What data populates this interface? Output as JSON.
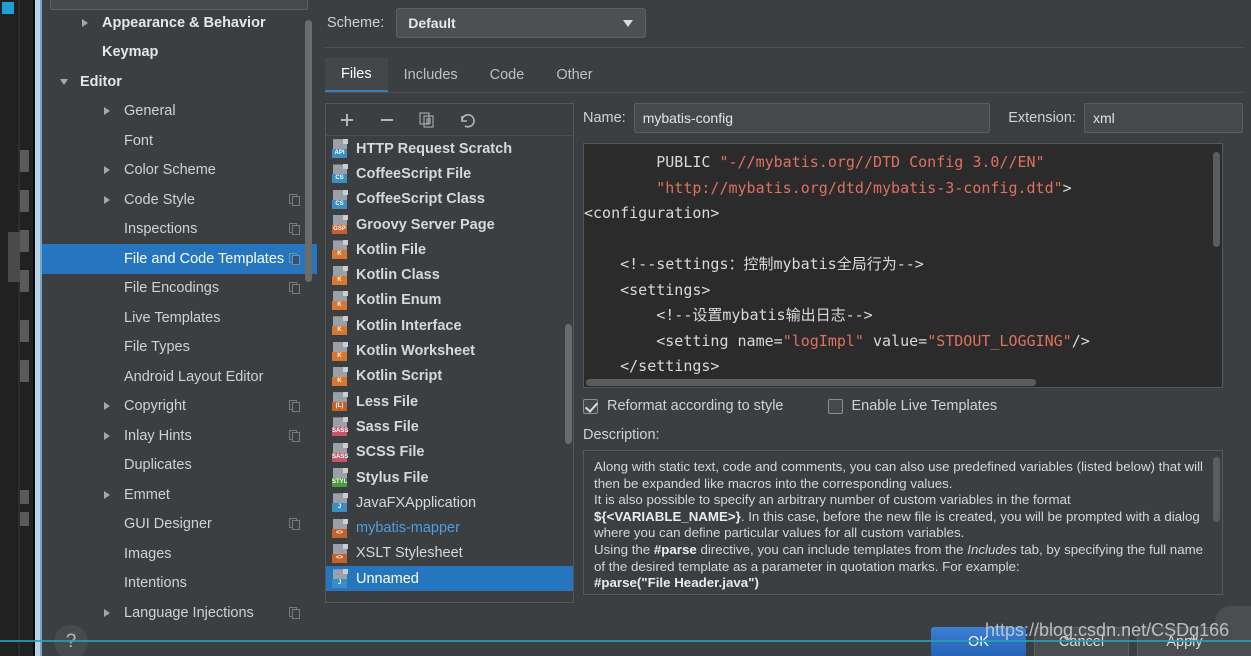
{
  "dialog": {
    "scheme_label": "Scheme:",
    "scheme_value": "Default",
    "tabs": [
      {
        "label": "Files",
        "active": true
      },
      {
        "label": "Includes",
        "active": false
      },
      {
        "label": "Code",
        "active": false
      },
      {
        "label": "Other",
        "active": false
      }
    ]
  },
  "sidebar": {
    "items": [
      {
        "label": "Appearance & Behavior",
        "indent": 1,
        "twisty": "right",
        "bold": true,
        "copy": false,
        "selected": false
      },
      {
        "label": "Keymap",
        "indent": 1,
        "twisty": "",
        "bold": true,
        "copy": false,
        "selected": false
      },
      {
        "label": "Editor",
        "indent": 0,
        "twisty": "down",
        "bold": true,
        "copy": false,
        "selected": false
      },
      {
        "label": "General",
        "indent": 2,
        "twisty": "right",
        "bold": false,
        "copy": false,
        "selected": false
      },
      {
        "label": "Font",
        "indent": 2,
        "twisty": "",
        "bold": false,
        "copy": false,
        "selected": false
      },
      {
        "label": "Color Scheme",
        "indent": 2,
        "twisty": "right",
        "bold": false,
        "copy": false,
        "selected": false
      },
      {
        "label": "Code Style",
        "indent": 2,
        "twisty": "right",
        "bold": false,
        "copy": true,
        "selected": false
      },
      {
        "label": "Inspections",
        "indent": 2,
        "twisty": "",
        "bold": false,
        "copy": true,
        "selected": false
      },
      {
        "label": "File and Code Templates",
        "indent": 2,
        "twisty": "",
        "bold": false,
        "copy": true,
        "selected": true
      },
      {
        "label": "File Encodings",
        "indent": 2,
        "twisty": "",
        "bold": false,
        "copy": true,
        "selected": false
      },
      {
        "label": "Live Templates",
        "indent": 2,
        "twisty": "",
        "bold": false,
        "copy": false,
        "selected": false
      },
      {
        "label": "File Types",
        "indent": 2,
        "twisty": "",
        "bold": false,
        "copy": false,
        "selected": false
      },
      {
        "label": "Android Layout Editor",
        "indent": 2,
        "twisty": "",
        "bold": false,
        "copy": false,
        "selected": false
      },
      {
        "label": "Copyright",
        "indent": 2,
        "twisty": "right",
        "bold": false,
        "copy": true,
        "selected": false
      },
      {
        "label": "Inlay Hints",
        "indent": 2,
        "twisty": "right",
        "bold": false,
        "copy": true,
        "selected": false
      },
      {
        "label": "Duplicates",
        "indent": 2,
        "twisty": "",
        "bold": false,
        "copy": false,
        "selected": false
      },
      {
        "label": "Emmet",
        "indent": 2,
        "twisty": "right",
        "bold": false,
        "copy": false,
        "selected": false
      },
      {
        "label": "GUI Designer",
        "indent": 2,
        "twisty": "",
        "bold": false,
        "copy": true,
        "selected": false
      },
      {
        "label": "Images",
        "indent": 2,
        "twisty": "",
        "bold": false,
        "copy": false,
        "selected": false
      },
      {
        "label": "Intentions",
        "indent": 2,
        "twisty": "",
        "bold": false,
        "copy": false,
        "selected": false
      },
      {
        "label": "Language Injections",
        "indent": 2,
        "twisty": "right",
        "bold": false,
        "copy": true,
        "selected": false
      }
    ]
  },
  "templates": {
    "toolbar": [
      {
        "icon": "add-icon",
        "title": "Add"
      },
      {
        "icon": "remove-icon",
        "title": "Remove"
      },
      {
        "icon": "copy-icon",
        "title": "Copy"
      },
      {
        "icon": "reset-icon",
        "title": "Reset"
      }
    ],
    "items": [
      {
        "label": "HTTP Request Scratch",
        "badge": "API",
        "badge_color": "#3b8dc4",
        "bold": true,
        "blue": false,
        "selected": false
      },
      {
        "label": "CoffeeScript File",
        "badge": "CS",
        "badge_color": "#3b8dc4",
        "bold": true,
        "blue": false,
        "selected": false
      },
      {
        "label": "CoffeeScript Class",
        "badge": "CS",
        "badge_color": "#3b8dc4",
        "bold": true,
        "blue": false,
        "selected": false
      },
      {
        "label": "Groovy Server Page",
        "badge": "GSP",
        "badge_color": "#c4622d",
        "bold": true,
        "blue": false,
        "selected": false
      },
      {
        "label": "Kotlin File",
        "badge": "K",
        "badge_color": "#d9762f",
        "bold": true,
        "blue": false,
        "selected": false
      },
      {
        "label": "Kotlin Class",
        "badge": "K",
        "badge_color": "#d9762f",
        "bold": true,
        "blue": false,
        "selected": false
      },
      {
        "label": "Kotlin Enum",
        "badge": "K",
        "badge_color": "#d9762f",
        "bold": true,
        "blue": false,
        "selected": false
      },
      {
        "label": "Kotlin Interface",
        "badge": "K",
        "badge_color": "#d9762f",
        "bold": true,
        "blue": false,
        "selected": false
      },
      {
        "label": "Kotlin Worksheet",
        "badge": "K",
        "badge_color": "#d9762f",
        "bold": true,
        "blue": false,
        "selected": false
      },
      {
        "label": "Kotlin Script",
        "badge": "K",
        "badge_color": "#d9762f",
        "bold": true,
        "blue": false,
        "selected": false
      },
      {
        "label": "Less File",
        "badge": "(L)",
        "badge_color": "#c4622d",
        "bold": true,
        "blue": false,
        "selected": false
      },
      {
        "label": "Sass File",
        "badge": "SASS",
        "badge_color": "#c2576b",
        "bold": true,
        "blue": false,
        "selected": false
      },
      {
        "label": "SCSS File",
        "badge": "SASS",
        "badge_color": "#c2576b",
        "bold": true,
        "blue": false,
        "selected": false
      },
      {
        "label": "Stylus File",
        "badge": "STYL",
        "badge_color": "#4c9a3e",
        "bold": true,
        "blue": false,
        "selected": false
      },
      {
        "label": "JavaFXApplication",
        "badge": "J",
        "badge_color": "#3b8dc4",
        "bold": false,
        "blue": false,
        "selected": false
      },
      {
        "label": "mybatis-mapper",
        "badge": "<>",
        "badge_color": "#c4622d",
        "bold": false,
        "blue": true,
        "selected": false
      },
      {
        "label": "XSLT Stylesheet",
        "badge": "<>",
        "badge_color": "#c4622d",
        "bold": false,
        "blue": false,
        "selected": false
      },
      {
        "label": "Unnamed",
        "badge": "J",
        "badge_color": "#3b8dc4",
        "bold": false,
        "blue": false,
        "selected": true
      }
    ]
  },
  "detail": {
    "name_label": "Name:",
    "name_value": "mybatis-config",
    "extension_label": "Extension:",
    "extension_value": "xml",
    "editor_lines": [
      {
        "indent": 8,
        "parts": [
          {
            "t": "PUBLIC ",
            "c": "plain"
          },
          {
            "t": "\"-//mybatis.org//DTD Config 3.0//EN\"",
            "c": "str"
          }
        ]
      },
      {
        "indent": 8,
        "parts": [
          {
            "t": "\"http://mybatis.org/dtd/mybatis-3-config.dtd\"",
            "c": "str"
          },
          {
            "t": ">",
            "c": "plain"
          }
        ]
      },
      {
        "indent": 0,
        "parts": [
          {
            "t": "<configuration>",
            "c": "plain"
          }
        ]
      },
      {
        "indent": 0,
        "parts": [
          {
            "t": "",
            "c": "plain"
          }
        ]
      },
      {
        "indent": 4,
        "parts": [
          {
            "t": "<!--settings：控制mybatis全局行为-->",
            "c": "plain"
          }
        ]
      },
      {
        "indent": 4,
        "parts": [
          {
            "t": "<settings>",
            "c": "plain"
          }
        ]
      },
      {
        "indent": 8,
        "parts": [
          {
            "t": "<!--设置mybatis输出日志-->",
            "c": "plain"
          }
        ]
      },
      {
        "indent": 8,
        "parts": [
          {
            "t": "<setting name=",
            "c": "plain"
          },
          {
            "t": "\"logImpl\"",
            "c": "str"
          },
          {
            "t": " value=",
            "c": "plain"
          },
          {
            "t": "\"STDOUT_LOGGING\"",
            "c": "str"
          },
          {
            "t": "/>",
            "c": "plain"
          }
        ]
      },
      {
        "indent": 4,
        "parts": [
          {
            "t": "</settings>",
            "c": "plain"
          }
        ]
      }
    ],
    "reformat_label": "Reformat according to style",
    "reformat_checked": true,
    "live_templates_label": "Enable Live Templates",
    "live_templates_checked": false,
    "description_label": "Description:",
    "description_html": "Along with static text, code and comments, you can also use predefined variables (listed below) that will then be expanded like macros into the corresponding values.<br>It is also possible to specify an arbitrary number of custom variables in the format <b>${&lt;VARIABLE_NAME&gt;}</b>. In this case, before the new file is created, you will be prompted with a dialog where you can define particular values for all custom variables.<br>Using the <b>#parse</b> directive, you can include templates from the <i>Includes</i> tab, by specifying the full name of the desired template as a parameter in quotation marks. For example:<br><b>#parse(\"File Header.java\")</b>"
  },
  "footer": {
    "help_label": "?",
    "ok_label": "OK",
    "cancel_label": "Cancel",
    "apply_label": "Apply",
    "watermark": "https://blog.csdn.net/CSDg166"
  },
  "colors": {
    "accent": "#2675bf",
    "ok_button": "#2c6fc4",
    "string_literal": "#e0705f",
    "panel_bg": "#3c3f41",
    "editor_bg": "#2b2b2b",
    "link_blue": "#4e9ee0",
    "watermark_line": "#2e9cb5"
  }
}
